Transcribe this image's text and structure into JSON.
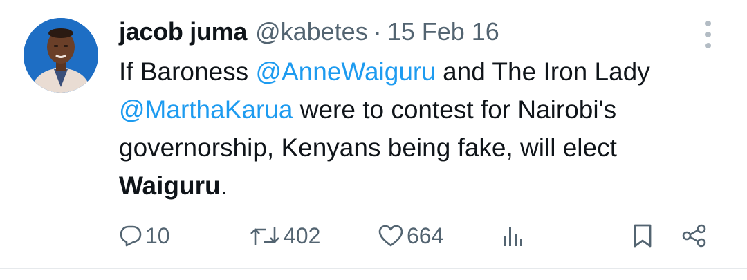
{
  "tweet": {
    "author": {
      "name": "jacob juma",
      "handle": "@kabetes"
    },
    "separator": "·",
    "date": "15 Feb 16",
    "text": {
      "t1": "If Baroness ",
      "m1": "@AnneWaiguru",
      "t2": " and The Iron Lady ",
      "m2": "@MarthaKarua",
      "t3": " were to contest for Nairobi's governorship, Kenyans being fake, will elect ",
      "b1": "Waiguru",
      "t4": "."
    },
    "stats": {
      "replies": "10",
      "retweets": "402",
      "likes": "664"
    }
  },
  "icons": {
    "more": "more-vertical-icon",
    "reply": "reply-icon",
    "retweet": "retweet-icon",
    "like": "heart-icon",
    "views": "analytics-icon",
    "bookmark": "bookmark-icon",
    "share": "share-icon"
  },
  "colors": {
    "mention": "#1d9bf0",
    "secondary_text": "#536471",
    "primary_text": "#0f1419"
  }
}
